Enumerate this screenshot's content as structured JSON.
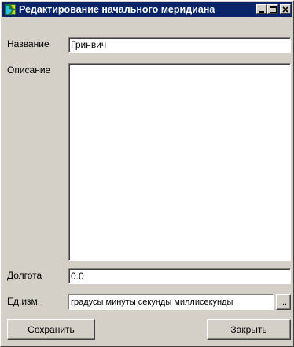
{
  "window": {
    "title": "Редактирование начального меридиана",
    "icon": "app-globe-icon",
    "controls": [
      "minimize-icon",
      "maximize-icon",
      "close-icon"
    ]
  },
  "form": {
    "name_label": "Название",
    "name_value": "Гринвич",
    "description_label": "Описание",
    "description_value": "",
    "longitude_label": "Долгота",
    "longitude_value": "0.0",
    "units_label": "Ед.изм.",
    "units_value": "градусы минуты секунды миллисекунды",
    "browse_label": "..."
  },
  "buttons": {
    "save_label": "Сохранить",
    "close_label": "Закрыть"
  },
  "colors": {
    "titlebar": "#0a246a",
    "face": "#d4d0c8"
  }
}
